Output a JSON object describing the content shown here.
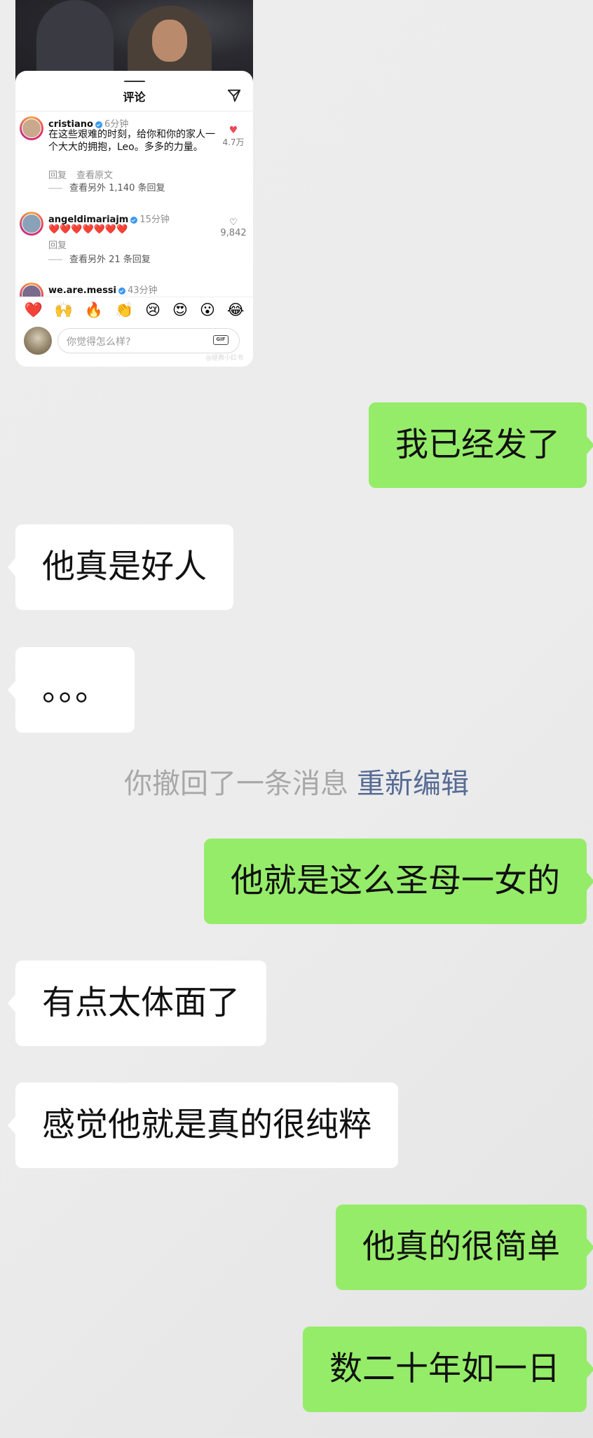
{
  "comments_sheet": {
    "title": "评论",
    "comments": [
      {
        "username": "cristiano",
        "time": "6分钟",
        "text": "在这些艰难的时刻，给你和你的家人一个大大的拥抱，Leo。多多的力量。",
        "actions": [
          "回复",
          "查看原文"
        ],
        "more_replies": "查看另外 1,140 条回复",
        "likes": "4.7万",
        "liked": true
      },
      {
        "username": "angeldimariajm",
        "time": "15分钟",
        "text": "❤️❤️❤️❤️❤️❤️❤️",
        "actions": [
          "回复"
        ],
        "more_replies": "查看另外 21 条回复",
        "likes": "9,842",
        "liked": false
      },
      {
        "username": "we.are.messi",
        "time": "43分钟"
      }
    ],
    "emoji_bar": [
      "❤️",
      "🙌",
      "🔥",
      "👏",
      "😢",
      "😍",
      "😮",
      "😂"
    ],
    "input_placeholder": "你觉得怎么样?",
    "gif_label": "GIF",
    "watermark": "@拯救小红书"
  },
  "chat": {
    "messages": [
      {
        "side": "out",
        "text": "我已经发了"
      },
      {
        "side": "in",
        "text": "他真是好人"
      },
      {
        "side": "in",
        "text": "。。。"
      },
      {
        "side": "out",
        "text": "他就是这么圣母一女的"
      },
      {
        "side": "in",
        "text": "有点太体面了"
      },
      {
        "side": "in",
        "text": "感觉他就是真的很纯粹"
      },
      {
        "side": "out",
        "text": "他真的很简单"
      },
      {
        "side": "out",
        "text": "数二十年如一日"
      }
    ],
    "recall_notice": "你撤回了一条消息",
    "recall_action": "重新编辑"
  },
  "colors": {
    "outgoing_bubble": "#95ec69",
    "incoming_bubble": "#ffffff",
    "link": "#576b95",
    "background": "#ededed"
  }
}
